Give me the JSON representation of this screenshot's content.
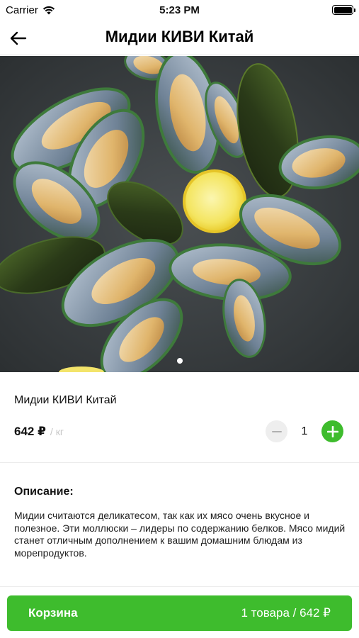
{
  "status_bar": {
    "carrier": "Carrier",
    "time": "5:23 PM"
  },
  "nav": {
    "title": "Мидии КИВИ Китай"
  },
  "carousel": {
    "image_subject": "mussels-with-lemon-photo",
    "page_count": 1,
    "current_page": 1
  },
  "product": {
    "name": "Мидии КИВИ Китай",
    "price": "642 ₽",
    "unit": "/ кг",
    "quantity": "1"
  },
  "description": {
    "title": "Описание:",
    "text": "Мидии считаются деликатесом, так как их мясо очень вкусное и полезное. Эти моллюски – лидеры по содержанию белков. Мясо мидий станет отличным дополнением к вашим домашним блюдам из морепродуктов."
  },
  "cart": {
    "label": "Корзина",
    "summary": "1 товара / 642 ₽"
  },
  "colors": {
    "accent": "#3ebc2d",
    "muted": "#c6c6c6",
    "minus_bg": "#eeeeee",
    "photo_bg": "#3c4042"
  }
}
